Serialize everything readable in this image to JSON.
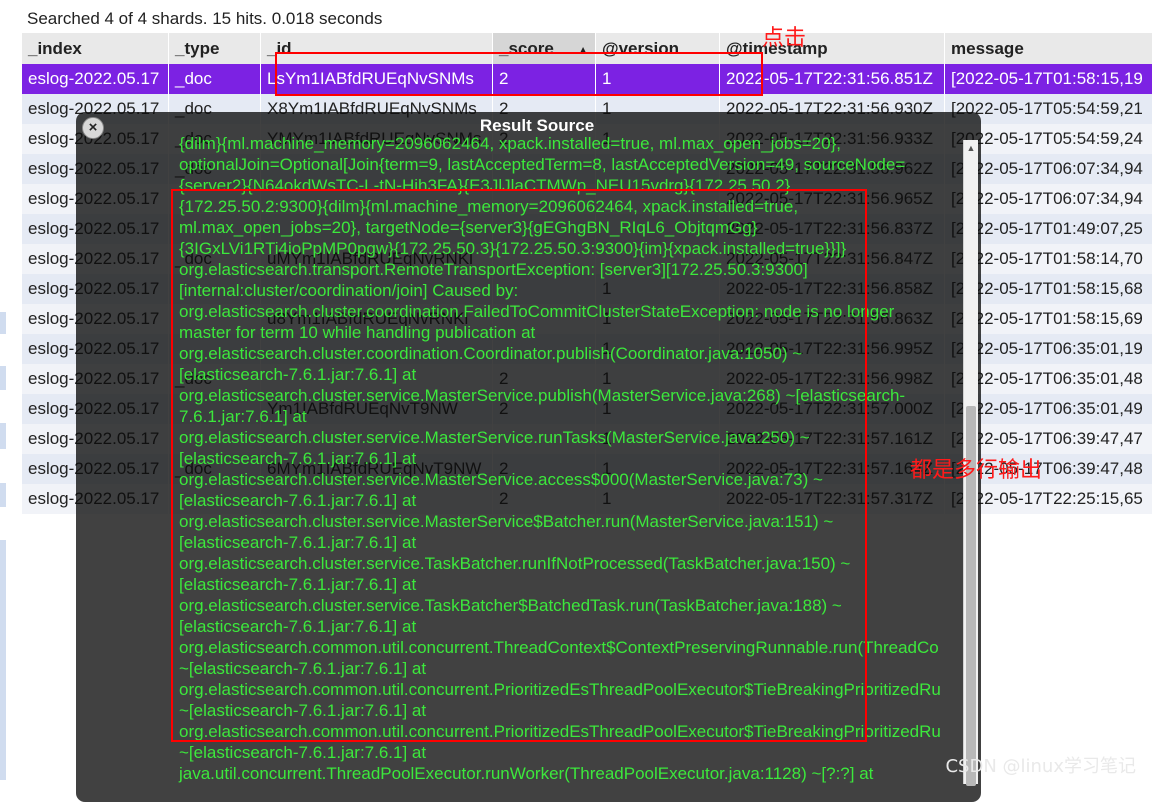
{
  "status": "Searched 4 of 4 shards. 15 hits. 0.018 seconds",
  "table": {
    "columns": [
      {
        "label": "_index",
        "sorted": false
      },
      {
        "label": "_type",
        "sorted": false
      },
      {
        "label": "_id",
        "sorted": false
      },
      {
        "label": "_score",
        "sorted": true
      },
      {
        "label": "@version",
        "sorted": false
      },
      {
        "label": "@timestamp",
        "sorted": false
      },
      {
        "label": "message",
        "sorted": false
      }
    ],
    "sort_indicator": "▲",
    "rows": [
      {
        "index": "eslog-2022.05.17",
        "type": "_doc",
        "id": "LsYm1IABfdRUEqNvSNMs",
        "score": "2",
        "version": "1",
        "timestamp": "2022-05-17T22:31:56.851Z",
        "message": "[2022-05-17T01:58:15,19",
        "selected": true
      },
      {
        "index": "eslog-2022.05.17",
        "type": "_doc",
        "id": "X8Ym1IABfdRUEqNvSNMs",
        "score": "2",
        "version": "1",
        "timestamp": "2022-05-17T22:31:56.930Z",
        "message": "[2022-05-17T05:54:59,21",
        "selected": false
      },
      {
        "index": "eslog-2022.05.17",
        "type": "_doc",
        "id": "YMYm1IABfdRUEqNvSNMs",
        "score": "2",
        "version": "1",
        "timestamp": "2022-05-17T22:31:56.933Z",
        "message": "[2022-05-17T05:54:59,24",
        "selected": false
      },
      {
        "index": "eslog-2022.05.17",
        "type": "_doc",
        "id": "",
        "score": "",
        "version": "",
        "timestamp": "2022-05-17T22:31:56.962Z",
        "message": "[2022-05-17T06:07:34,94",
        "selected": false
      },
      {
        "index": "eslog-2022.05.17",
        "type": "",
        "id": "",
        "score": "",
        "version": "",
        "timestamp": "2022-05-17T22:31:56.965Z",
        "message": "[2022-05-17T06:07:34,94",
        "selected": false
      },
      {
        "index": "eslog-2022.05.17",
        "type": "",
        "id": "",
        "score": "",
        "version": "",
        "timestamp": "2022-05-17T22:31:56.837Z",
        "message": "[2022-05-17T01:49:07,25",
        "selected": false
      },
      {
        "index": "eslog-2022.05.17",
        "type": "_doc",
        "id": "uMYm1IABfdRUEqNvRNKl",
        "score": "",
        "version": "",
        "timestamp": "2022-05-17T22:31:56.847Z",
        "message": "[2022-05-17T01:58:14,70",
        "selected": false
      },
      {
        "index": "eslog-2022.05.17",
        "type": "",
        "id": "",
        "score": "",
        "version": "1",
        "timestamp": "2022-05-17T22:31:56.858Z",
        "message": "[2022-05-17T01:58:15,68",
        "selected": false
      },
      {
        "index": "eslog-2022.05.17",
        "type": "",
        "id": "u8Ym1IABfdRUEqNvRNKl",
        "score": "",
        "version": "1",
        "timestamp": "2022-05-17T22:31:56.863Z",
        "message": "[2022-05-17T01:58:15,69",
        "selected": false
      },
      {
        "index": "eslog-2022.05.17",
        "type": "",
        "id": "",
        "score": "",
        "version": "1",
        "timestamp": "2022-05-17T22:31:56.995Z",
        "message": "[2022-05-17T06:35:01,19",
        "selected": false
      },
      {
        "index": "eslog-2022.05.17",
        "type": "_doc",
        "id": "",
        "score": "2",
        "version": "1",
        "timestamp": "2022-05-17T22:31:56.998Z",
        "message": "[2022-05-17T06:35:01,48",
        "selected": false
      },
      {
        "index": "eslog-2022.05.17",
        "type": "",
        "id": "Ym1IABfdRUEqNvT9NW",
        "score": "2",
        "version": "1",
        "timestamp": "2022-05-17T22:31:57.000Z",
        "message": "[2022-05-17T06:35:01,49",
        "selected": false
      },
      {
        "index": "eslog-2022.05.17",
        "type": "",
        "id": "",
        "score": "",
        "version": "1",
        "timestamp": "2022-05-17T22:31:57.161Z",
        "message": "[2022-05-17T06:39:47,47",
        "selected": false
      },
      {
        "index": "eslog-2022.05.17",
        "type": "_doc",
        "id": "6MYm1IABfdRUEqNvT9NW",
        "score": "2",
        "version": "1",
        "timestamp": "2022-05-17T22:31:57.164Z",
        "message": "[2022-05-17T06:39:47,48",
        "selected": false
      },
      {
        "index": "eslog-2022.05.17",
        "type": "",
        "id": "",
        "score": "2",
        "version": "1",
        "timestamp": "2022-05-17T22:31:57.317Z",
        "message": "[2022-05-17T22:25:15,65",
        "selected": false
      }
    ]
  },
  "dialog": {
    "title": "Result Source",
    "close_glyph": "×",
    "source_lines": [
      "{dilm}{ml.machine_memory=2096062464, xpack.installed=true, ml.max_open_jobs=20},",
      "optionalJoin=Optional[Join{term=9, lastAcceptedTerm=8, lastAcceptedVersion=49, sourceNode=",
      "{server2}{N64okdWsTC-L-tN-Hih3FA}{E3JlJlaCTMWp_NEU15vdrg}{172.25.50.2}",
      "{172.25.50.2:9300}{dilm}{ml.machine_memory=2096062464, xpack.installed=true,",
      "ml.max_open_jobs=20}, targetNode={server3}{gEGhgBN_RIqL6_ObjtqmGg}",
      "{3IGxLVi1RTi4ioPpMP0pgw}{172.25.50.3}{172.25.50.3:9300}{im}{xpack.installed=true}}]}",
      "org.elasticsearch.transport.RemoteTransportException: [server3][172.25.50.3:9300]",
      "[internal:cluster/coordination/join] Caused by:",
      "org.elasticsearch.cluster.coordination.FailedToCommitClusterStateException: node is no longer",
      "master for term 10 while handling publication at",
      "org.elasticsearch.cluster.coordination.Coordinator.publish(Coordinator.java:1050) ~",
      "[elasticsearch-7.6.1.jar:7.6.1] at",
      "org.elasticsearch.cluster.service.MasterService.publish(MasterService.java:268) ~[elasticsearch-",
      "7.6.1.jar:7.6.1] at",
      "org.elasticsearch.cluster.service.MasterService.runTasks(MasterService.java:250) ~",
      "[elasticsearch-7.6.1.jar:7.6.1] at",
      "org.elasticsearch.cluster.service.MasterService.access$000(MasterService.java:73) ~",
      "[elasticsearch-7.6.1.jar:7.6.1] at",
      "org.elasticsearch.cluster.service.MasterService$Batcher.run(MasterService.java:151) ~",
      "[elasticsearch-7.6.1.jar:7.6.1] at",
      "org.elasticsearch.cluster.service.TaskBatcher.runIfNotProcessed(TaskBatcher.java:150) ~",
      "[elasticsearch-7.6.1.jar:7.6.1] at",
      "org.elasticsearch.cluster.service.TaskBatcher$BatchedTask.run(TaskBatcher.java:188) ~",
      "[elasticsearch-7.6.1.jar:7.6.1] at",
      "org.elasticsearch.common.util.concurrent.ThreadContext$ContextPreservingRunnable.run(ThreadCo",
      "~[elasticsearch-7.6.1.jar:7.6.1] at",
      "org.elasticsearch.common.util.concurrent.PrioritizedEsThreadPoolExecutor$TieBreakingPrioritizedRu",
      "~[elasticsearch-7.6.1.jar:7.6.1] at",
      "org.elasticsearch.common.util.concurrent.PrioritizedEsThreadPoolExecutor$TieBreakingPrioritizedRu",
      "~[elasticsearch-7.6.1.jar:7.6.1] at",
      "java.util.concurrent.ThreadPoolExecutor.runWorker(ThreadPoolExecutor.java:1128) ~[?:?] at"
    ]
  },
  "annotations": {
    "click_note": "点击",
    "multiline_note": "都是多行输出",
    "watermark": "CSDN @linux学习笔记"
  },
  "colors": {
    "selected_row": "#7c22e3",
    "source_text": "#3ce83c",
    "annotation_red": "#ff0000"
  }
}
